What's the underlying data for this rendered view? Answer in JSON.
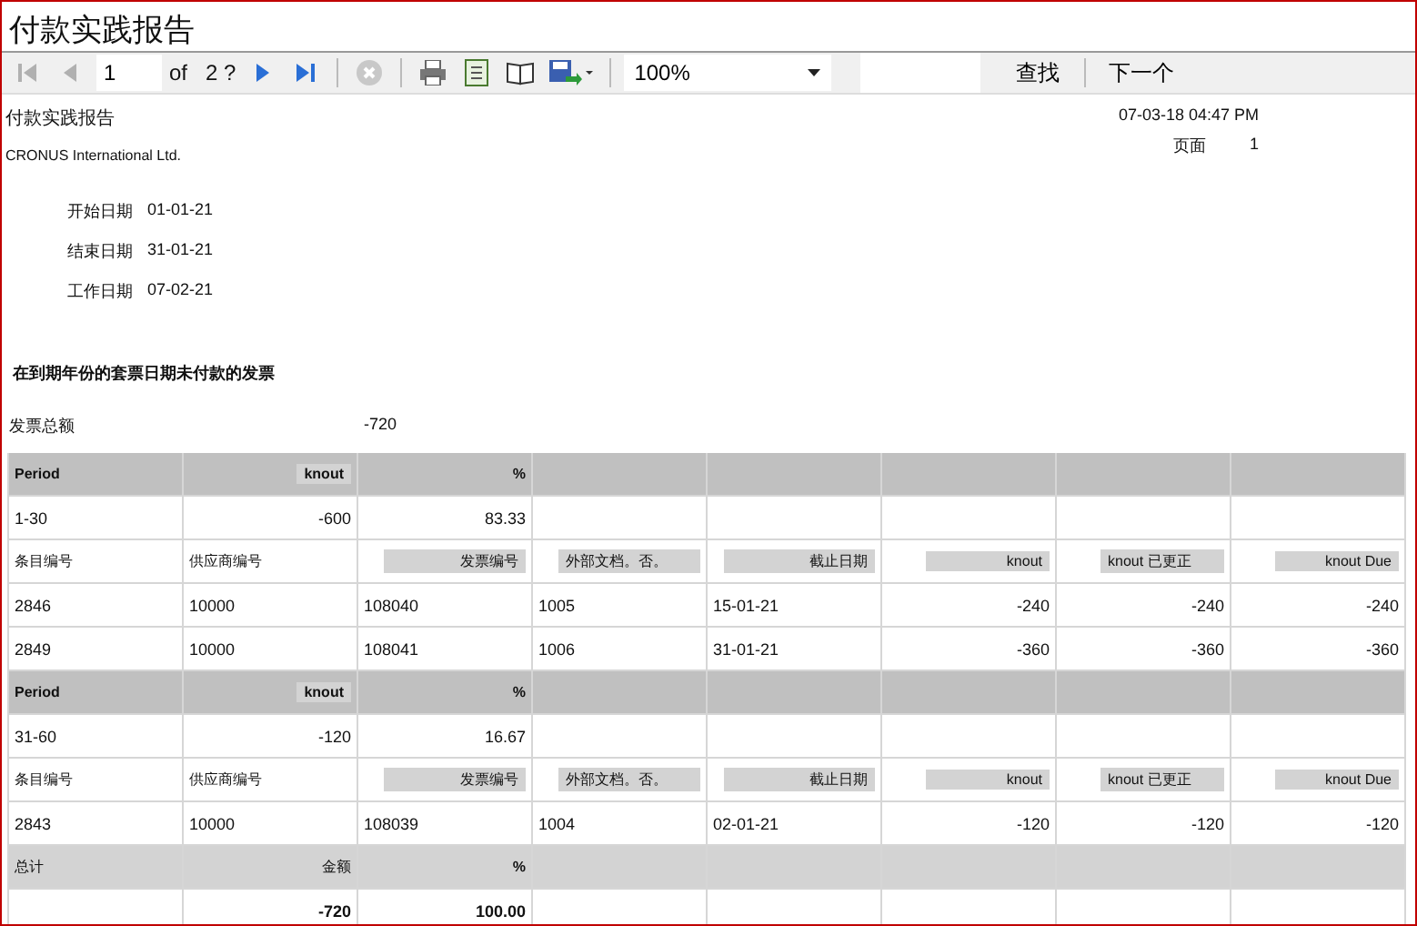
{
  "window": {
    "title": "付款实践报告"
  },
  "toolbar": {
    "nav": [
      {
        "kind": "first",
        "disabled": true
      },
      {
        "kind": "prev",
        "disabled": true
      }
    ],
    "page": "1",
    "of": "of",
    "total": "2 ?",
    "nav2": [
      {
        "kind": "next",
        "disabled": false
      },
      {
        "kind": "last",
        "disabled": false
      }
    ],
    "zoom": "100%",
    "find": "查找",
    "next_match": "下一个"
  },
  "report": {
    "title": "付款实践报告",
    "company": "CRONUS International Ltd.",
    "datetime": "07-03-18 04:47 PM",
    "page_label": "页面",
    "page": "1",
    "dates": [
      {
        "label": "开始日期",
        "value": "01-01-21"
      },
      {
        "label": "结束日期",
        "value": "31-01-21"
      },
      {
        "label": "工作日期",
        "value": "07-02-21"
      }
    ],
    "heading": "在到期年份的套票日期未付款的发票",
    "invoice_total_label": "发票总额",
    "invoice_total": "-720",
    "sections": [
      {
        "header": [
          "Period",
          "knout",
          "%"
        ],
        "summary": [
          "1-30",
          "-600",
          "83.33"
        ],
        "columns": [
          "条目编号",
          "供应商编号",
          "发票编号",
          "外部文档。否。",
          "截止日期",
          "knout",
          "knout 已更正",
          "knout Due"
        ],
        "rows": [
          [
            "2846",
            "10000",
            "108040",
            "1005",
            "15-01-21",
            "-240",
            "-240",
            "-240"
          ],
          [
            "2849",
            "10000",
            "108041",
            "1006",
            "31-01-21",
            "-360",
            "-360",
            "-360"
          ]
        ]
      },
      {
        "header": [
          "Period",
          "knout",
          "%"
        ],
        "summary": [
          "31-60",
          "-120",
          "16.67"
        ],
        "columns": [
          "条目编号",
          "供应商编号",
          "发票编号",
          "外部文档。否。",
          "截止日期",
          "knout",
          "knout 已更正",
          "knout Due"
        ],
        "rows": [
          [
            "2843",
            "10000",
            "108039",
            "1004",
            "02-01-21",
            "-120",
            "-120",
            "-120"
          ]
        ]
      }
    ],
    "total": {
      "header": [
        "总计",
        "金额",
        "%"
      ],
      "values": [
        "-720",
        "100.00"
      ]
    }
  }
}
